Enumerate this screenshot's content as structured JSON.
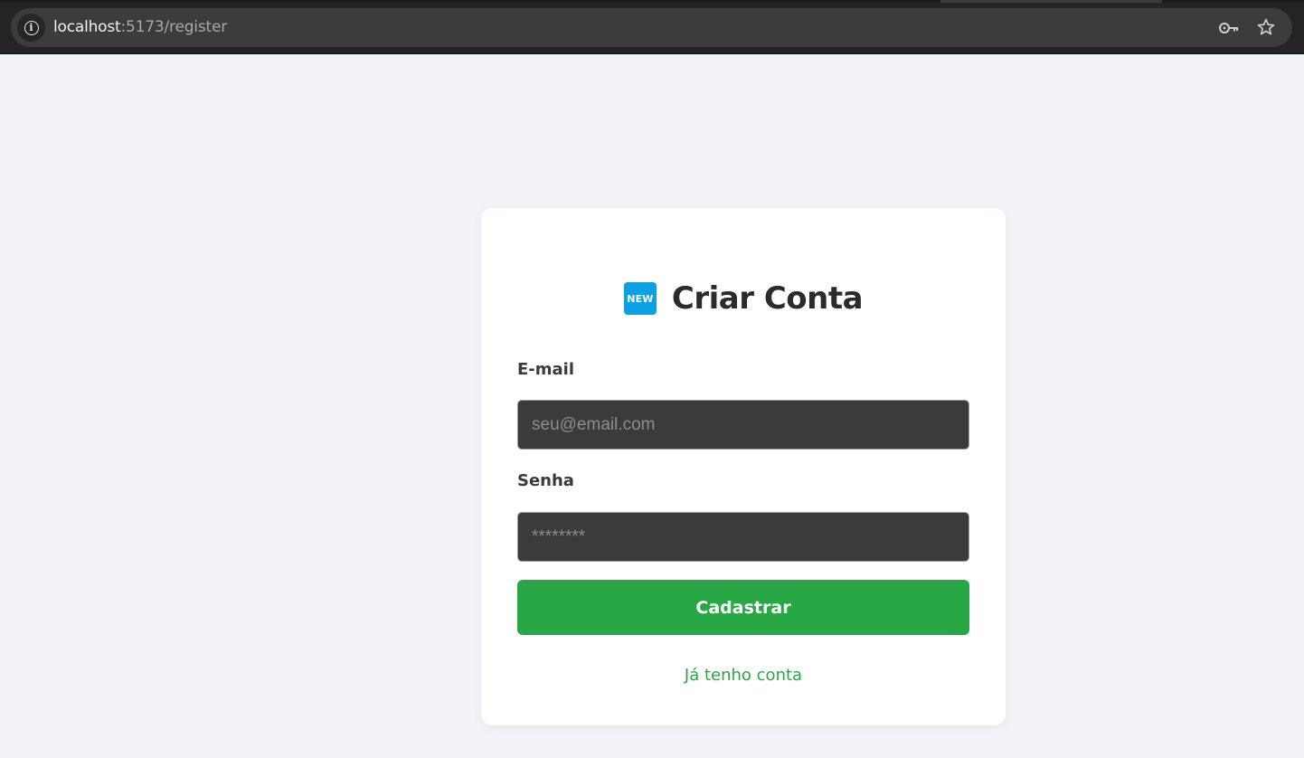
{
  "browser": {
    "url_host": "localhost",
    "url_rest": ":5173/register",
    "icons": [
      "info-icon",
      "key-icon",
      "star-icon"
    ]
  },
  "form": {
    "badge_text": "NEW",
    "title": "Criar Conta",
    "email_label": "E-mail",
    "email_placeholder": "seu@email.com",
    "email_value": "",
    "password_label": "Senha",
    "password_placeholder": "********",
    "password_value": "",
    "submit_label": "Cadastrar",
    "login_link": "Já tenho conta"
  },
  "colors": {
    "page_bg": "#f2f3f7",
    "card_bg": "#ffffff",
    "input_bg": "#3b3b3b",
    "primary_green": "#28a745",
    "badge_blue": "#0ba1e4",
    "title_text": "#2b2b2b"
  }
}
